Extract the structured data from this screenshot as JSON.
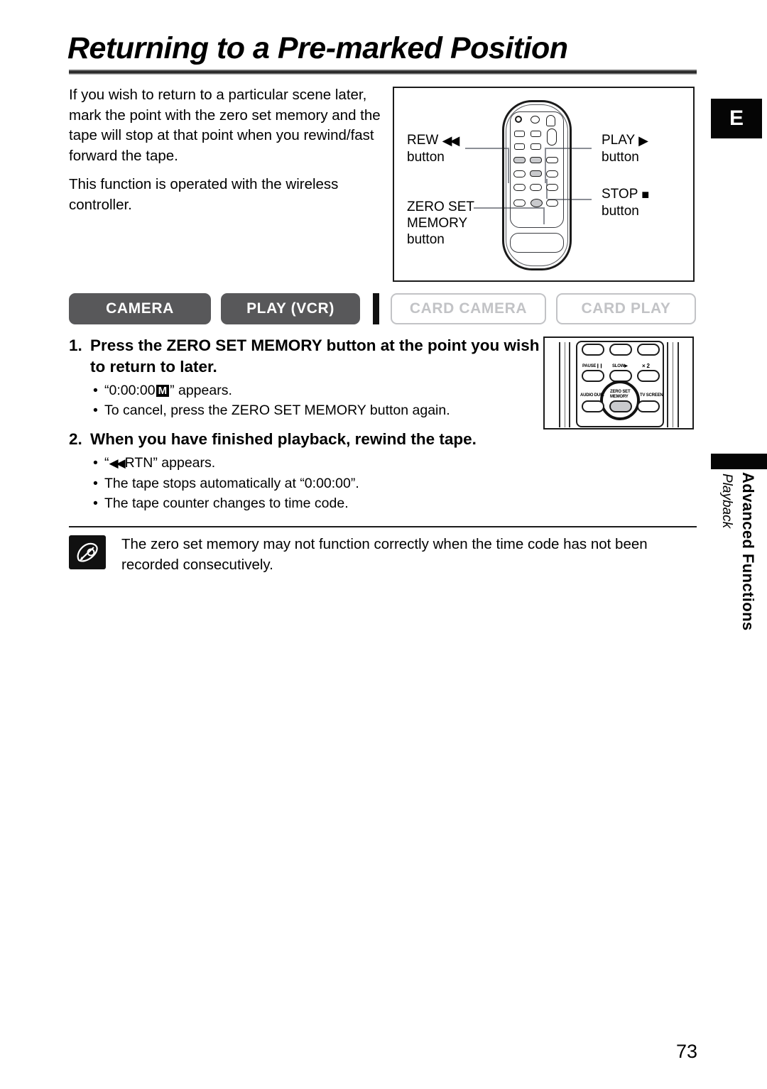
{
  "page": {
    "title": "Returning to a Pre-marked Position",
    "number": "73"
  },
  "intro": {
    "paragraph1": "If you wish to return to a particular scene later, mark the point with the zero set memory and the tape will stop at that point when you rewind/fast forward the tape.",
    "paragraph2": "This function is operated with the wireless controller."
  },
  "remote_figure": {
    "callouts": {
      "rew_label": "REW",
      "rew_glyph": "◀◀",
      "rew_sub": "button",
      "play_label": "PLAY",
      "play_glyph": "▶",
      "play_sub": "button",
      "stop_label": "STOP",
      "stop_glyph": "■",
      "stop_sub": "button",
      "zsm_line1": "ZERO SET",
      "zsm_line2": "MEMORY",
      "zsm_sub": "button"
    }
  },
  "modes": [
    {
      "label": "CAMERA",
      "active": true
    },
    {
      "label": "PLAY (VCR)",
      "active": true
    },
    {
      "label": "CARD CAMERA",
      "active": false
    },
    {
      "label": "CARD PLAY",
      "active": false
    }
  ],
  "steps": [
    {
      "number": "1.",
      "text": "Press the ZERO SET MEMORY button at the point you wish to return to later.",
      "bullets": [
        {
          "prefix": "“0:00:00",
          "badge": "M",
          "suffix": "” appears."
        },
        {
          "text": "To cancel, press the ZERO SET MEMORY button again."
        }
      ]
    },
    {
      "number": "2.",
      "text": "When you have finished playback, rewind the tape.",
      "bullets": [
        {
          "prefix": "“",
          "glyph": "◀◀",
          "suffix": "RTN” appears."
        },
        {
          "text": "The tape stops automatically at “0:00:00”."
        },
        {
          "text": "The tape counter changes to time code."
        }
      ]
    }
  ],
  "detail_figure": {
    "buttons": [
      {
        "label": "PAUSE",
        "glyph": "❙❙"
      },
      {
        "label": "SLOW",
        "glyph": "▶"
      },
      {
        "label": "× 2",
        "glyph": ""
      },
      {
        "label": "AUDIO DUB.",
        "glyph": ""
      },
      {
        "label": "ZERO SET",
        "glyph": ""
      },
      {
        "label": "MEMORY",
        "glyph": ""
      },
      {
        "label": "TV SCREEN",
        "glyph": ""
      }
    ]
  },
  "note": {
    "text": "The zero set memory may not function correctly when the time code has not been recorded consecutively."
  },
  "sidebar": {
    "language_tab": "E",
    "section_main": "Advanced Functions",
    "section_sub": "Playback"
  },
  "colors": {
    "mode_active_bg": "#58585a",
    "mode_inactive_border": "#c2c3c6",
    "leader_line": "#8c8f96",
    "ink": "#1b1b1b"
  }
}
